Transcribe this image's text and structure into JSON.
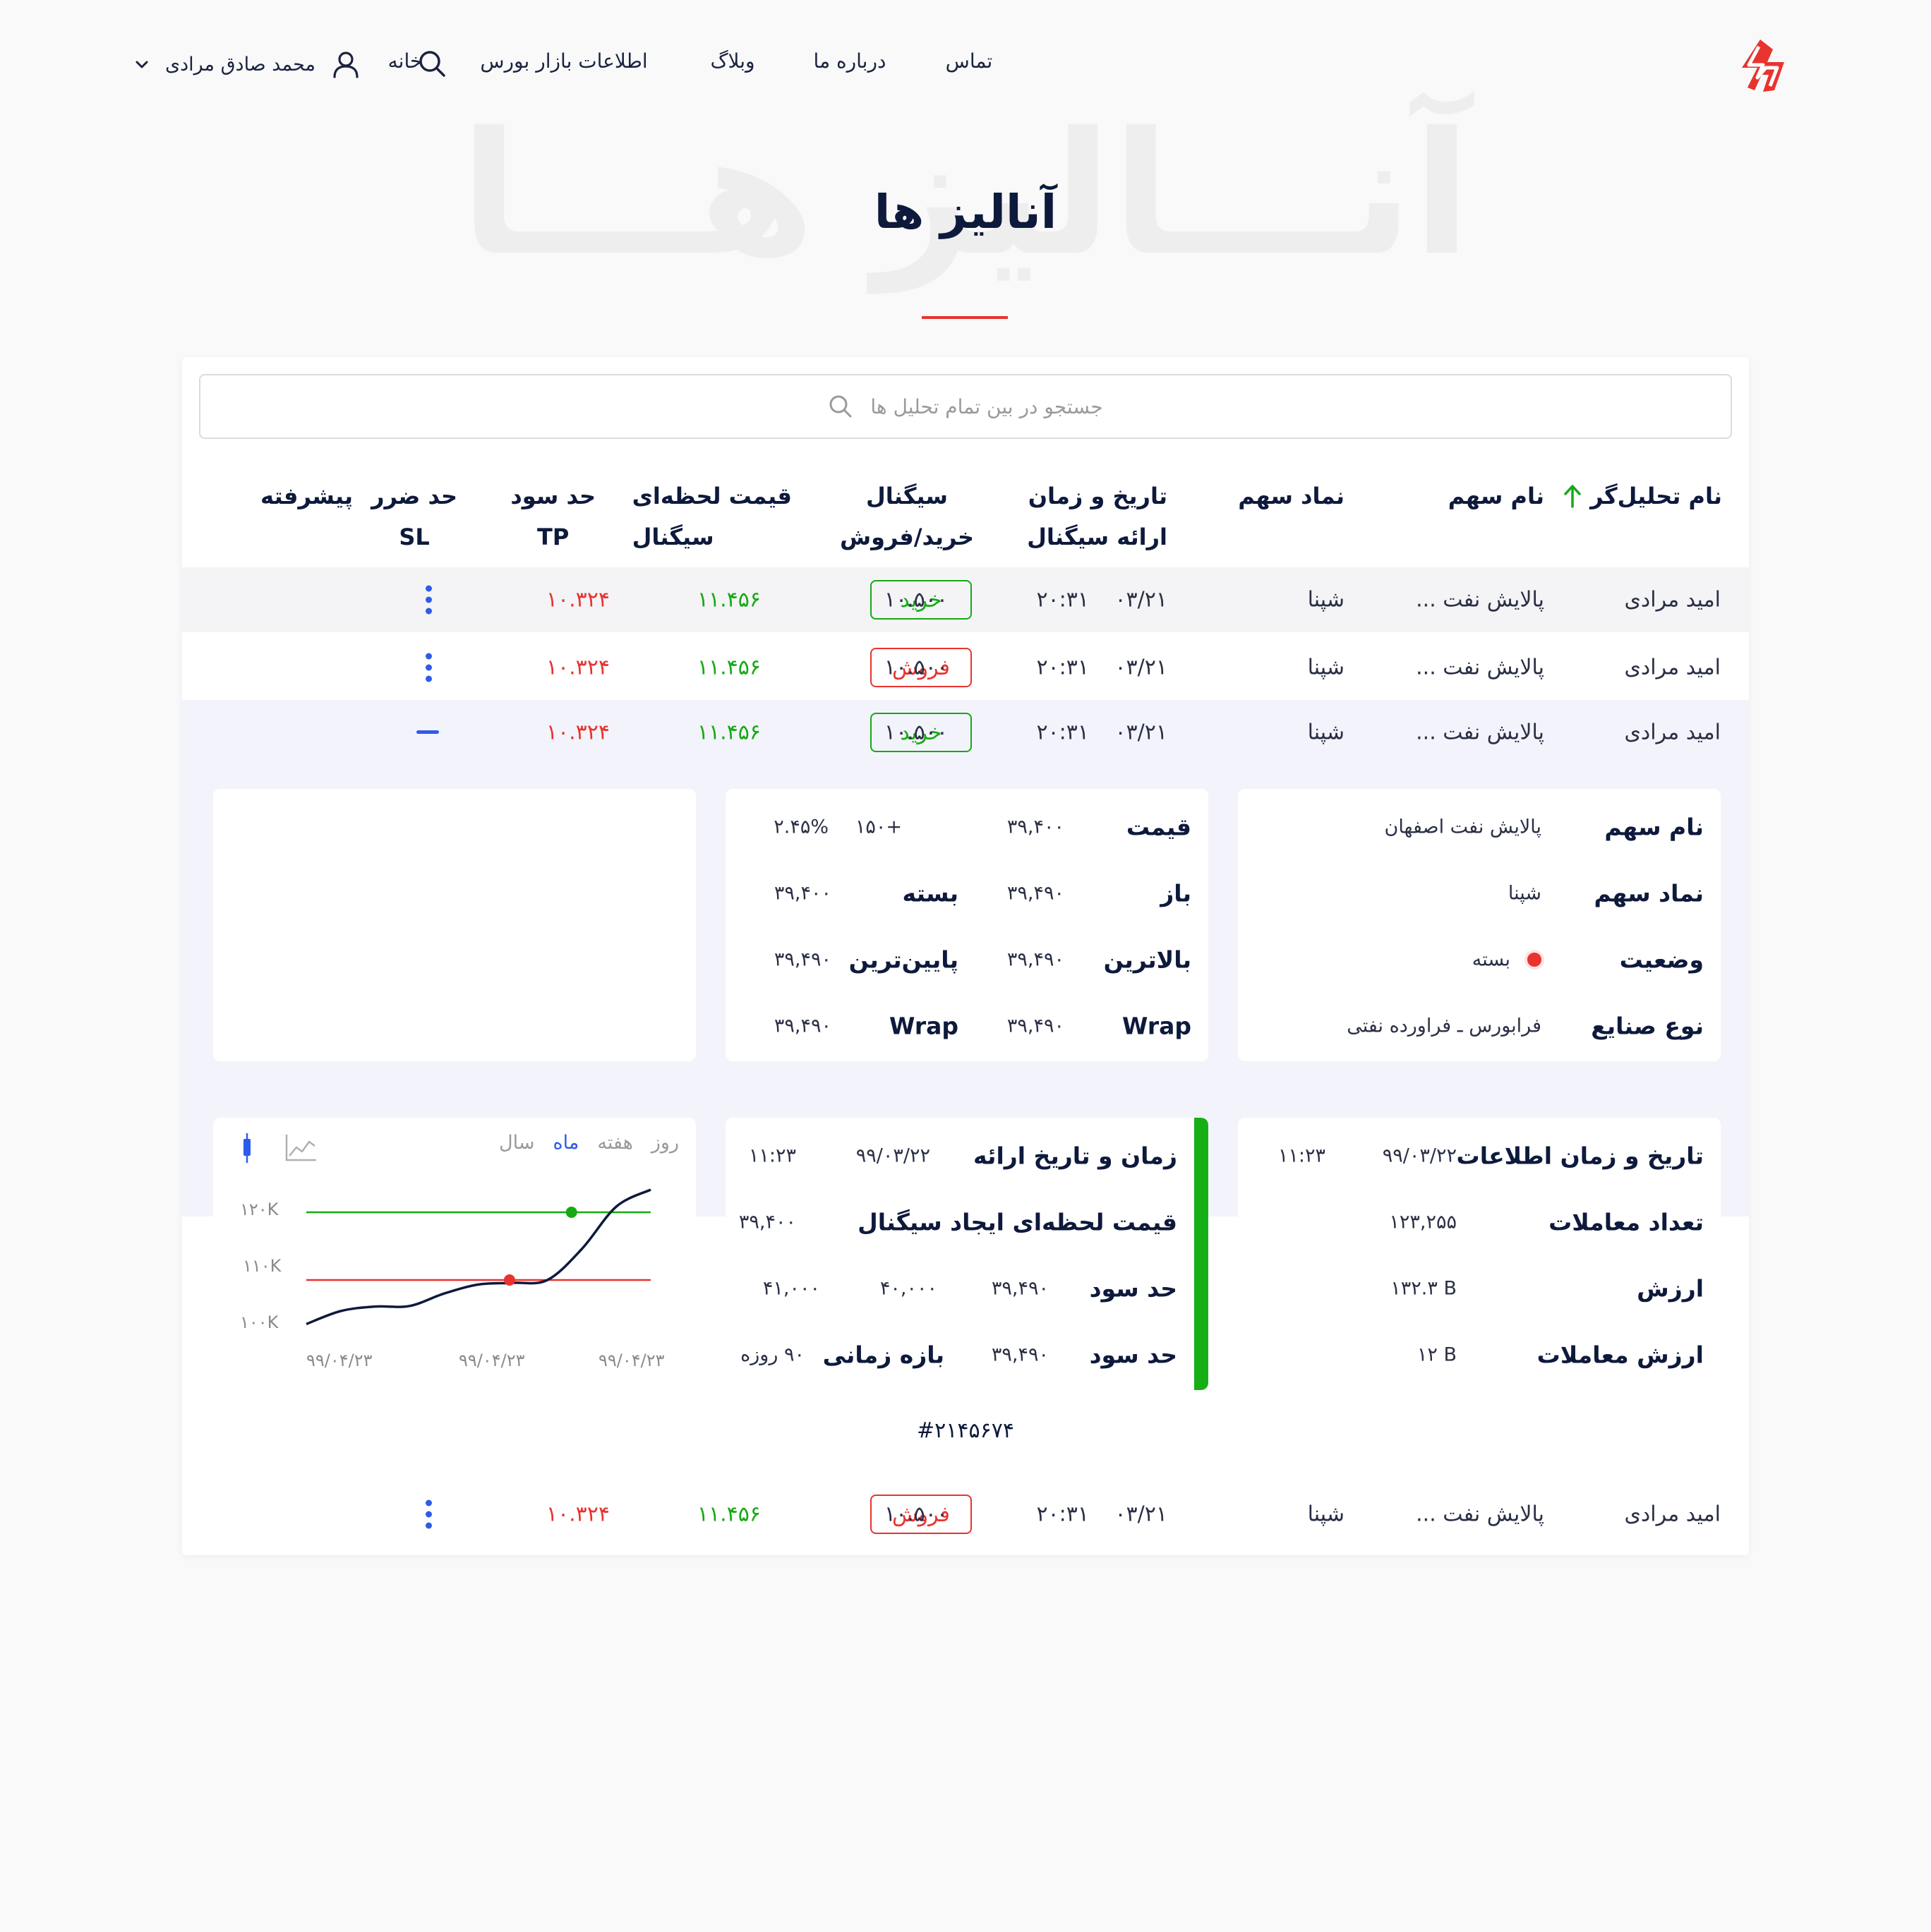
{
  "nav": {
    "items": [
      "خانه",
      "اطلاعات بازار بورس",
      "وبلاگ",
      "درباره ما",
      "تماس"
    ],
    "user_name": "محمد صادق مرادی"
  },
  "page": {
    "ghost_title": "آنـــالیز هـــا",
    "title": "آنالیز ها"
  },
  "search": {
    "placeholder": "جستجو در بین تمام تحلیل ها"
  },
  "table": {
    "headers": {
      "analyst": "نام تحلیل‌گر",
      "stock_name": "نام سهم",
      "symbol": "نماد سهم",
      "datetime_1": "تاریخ و زمان",
      "datetime_2": "ارائه سیگنال",
      "signal_1": "سیگنال",
      "signal_2": "خرید/فروش",
      "price_1": "قیمت لحظه‌ای",
      "price_2": "سیگنال",
      "tp_1": "حد سود",
      "tp_2": "TP",
      "sl_1": "حد ضرر",
      "sl_2": "SL",
      "advanced": "پیشرفته"
    },
    "rows": [
      {
        "analyst": "امید مرادی",
        "stock": "پالایش نفت ...",
        "symbol": "شپنا",
        "date": "۰۳/۲۱",
        "time": "۲۰:۳۱",
        "signal": "خرید",
        "price": "۱۰.۵۰۰",
        "tp": "۱۱.۴۵۶",
        "sl": "۱۰.۳۲۴"
      },
      {
        "analyst": "امید مرادی",
        "stock": "پالایش نفت ...",
        "symbol": "شپنا",
        "date": "۰۳/۲۱",
        "time": "۲۰:۳۱",
        "signal": "فروش",
        "price": "۱۰.۵۰۰",
        "tp": "۱۱.۴۵۶",
        "sl": "۱۰.۳۲۴"
      },
      {
        "analyst": "امید مرادی",
        "stock": "پالایش نفت ...",
        "symbol": "شپنا",
        "date": "۰۳/۲۱",
        "time": "۲۰:۳۱",
        "signal": "خرید",
        "price": "۱۰.۵۰۰",
        "tp": "۱۱.۴۵۶",
        "sl": "۱۰.۳۲۴"
      },
      {
        "analyst": "امید مرادی",
        "stock": "پالایش نفت ...",
        "symbol": "شپنا",
        "date": "۰۳/۲۱",
        "time": "۲۰:۳۱",
        "signal": "فروش",
        "price": "۱۰.۵۰۰",
        "tp": "۱۱.۴۵۶",
        "sl": "۱۰.۳۲۴"
      }
    ]
  },
  "details": {
    "info": {
      "name_label": "نام سهم",
      "name_value": "پالایش نفت اصفهان",
      "symbol_label": "نماد سهم",
      "symbol_value": "شپنا",
      "status_label": "وضعیت",
      "status_value": "بسته",
      "industry_label": "نوع صنایع",
      "industry_value": "فرابورس ـ فراورده نفتی"
    },
    "prices": {
      "price_label": "قیمت",
      "price_value": "۳۹,۴۰۰",
      "change": "+۱۵۰",
      "change_pct": "۲.۴۵%",
      "open_label": "باز",
      "open_value": "۳۹,۴۹۰",
      "close_label": "بسته",
      "close_value": "۳۹,۴۰۰",
      "high_label": "بالاترین",
      "high_value": "۳۹,۴۹۰",
      "low_label": "پایین‌ترین",
      "low_value": "۳۹,۴۹۰",
      "wrap1_label": "Wrap",
      "wrap1_value": "۳۹,۴۹۰",
      "wrap2_label": "Wrap",
      "wrap2_value": "۳۹,۴۹۰"
    },
    "trade": {
      "date_label": "تاریخ و زمان اطلاعات",
      "date_value": "۹۹/۰۳/۲۲",
      "time_value": "۱۱:۲۳",
      "count_label": "تعداد معاملات",
      "count_value": "۱۲۳,۲۵۵",
      "value_label": "ارزش",
      "value_value": "۱۳۲.۳ B",
      "tvalue_label": "ارزش معاملات",
      "tvalue_value": "۱۲ B"
    },
    "signal": {
      "time_label": "زمان و تاریخ ارائه",
      "date_value": "۹۹/۰۳/۲۲",
      "time_value": "۱۱:۲۳",
      "price_label": "قیمت لحظه‌ای ایجاد سیگنال",
      "price_value": "۳۹,۴۰۰",
      "tp_label": "حد سود",
      "tp1": "۳۹,۴۹۰",
      "tp2": "۴۰,۰۰۰",
      "tp3": "۴۱,۰۰۰",
      "sl_label": "حد سود",
      "sl_value": "۳۹,۴۹۰",
      "period_label": "بازه زمانی",
      "period_value": "۹۰ روزه"
    },
    "hash": "#۲۱۴۵۶۷۴"
  },
  "chart_tabs": [
    "روز",
    "هفته",
    "ماه",
    "سال"
  ],
  "chart_active_tab": "ماه",
  "chart_data": {
    "type": "line",
    "y_ticks": [
      "۱۲۰K",
      "۱۱۰K",
      "۱۰۰K"
    ],
    "x_ticks": [
      "۹۹/۰۴/۲۳",
      "۹۹/۰۴/۲۳",
      "۹۹/۰۴/۲۳"
    ],
    "ylim": [
      100,
      120
    ],
    "x": [
      0,
      10,
      20,
      30,
      40,
      50,
      60,
      70,
      80,
      90,
      100
    ],
    "values": [
      100.2,
      102.5,
      103.3,
      103.4,
      105.6,
      107.2,
      107.5,
      108.0,
      113.5,
      121.0,
      124.0
    ],
    "reference_lines": [
      {
        "value": 120,
        "color": "#16a915"
      },
      {
        "value": 108,
        "color": "#e8332f"
      }
    ],
    "markers": [
      {
        "x": 77,
        "y": 120,
        "color": "#16a915"
      },
      {
        "x": 59,
        "y": 108,
        "color": "#e8332f"
      }
    ],
    "line_color": "#0e1a3c"
  },
  "colors": {
    "accent": "#e8332f",
    "buy": "#16a915",
    "sell": "#e8332f",
    "link": "#2f5be8"
  }
}
